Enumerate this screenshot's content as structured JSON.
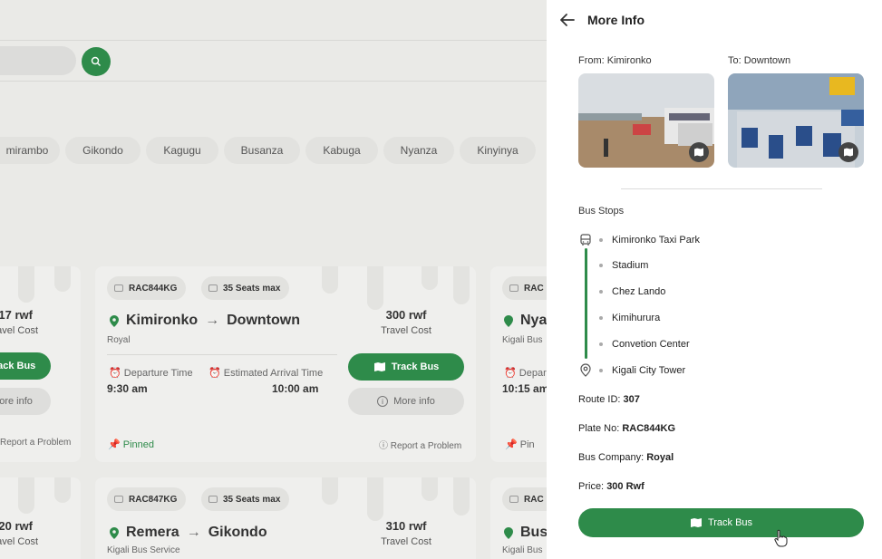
{
  "chips": [
    "mirambo",
    "Gikondo",
    "Kagugu",
    "Busanza",
    "Kabuga",
    "Nyanza",
    "Kinyinya"
  ],
  "cards": {
    "left_top": {
      "price": "17 rwf",
      "price_label": "avel Cost",
      "track": "Track Bus",
      "more": "More info",
      "report": "Report a Problem"
    },
    "main_top": {
      "plate": "RAC844KG",
      "seats": "35 Seats max",
      "from": "Kimironko",
      "to": "Downtown",
      "company": "Royal",
      "price": "300 rwf",
      "price_label": "Travel Cost",
      "dep_label": "Departure Time",
      "arr_label": "Estimated Arrival Time",
      "dep": "9:30 am",
      "arr": "10:00 am",
      "track": "Track Bus",
      "more": "More info",
      "pinned": "Pinned",
      "report": "Report a Problem"
    },
    "right_top": {
      "plate": "RAC",
      "from": "Nya",
      "company": "Kigali Bus",
      "dep_label": "Depar",
      "dep": "10:15 am",
      "pin": "Pin"
    },
    "left_bottom": {
      "price": "20 rwf",
      "price_label": "avel Cost"
    },
    "main_bottom": {
      "plate": "RAC847KG",
      "seats": "35 Seats max",
      "from": "Remera",
      "to": "Gikondo",
      "company": "Kigali Bus Service",
      "price": "310 rwf",
      "price_label": "Travel Cost"
    },
    "right_bottom": {
      "plate": "RAC",
      "from": "Bus",
      "company": "Kigali Bus"
    }
  },
  "panel": {
    "title": "More Info",
    "from_label": "From: Kimironko",
    "to_label": "To: Downtown",
    "bus_stops_label": "Bus Stops",
    "stops": [
      "Kimironko Taxi Park",
      "Stadium",
      "Chez Lando",
      "Kimihurura",
      "Convetion Center",
      "Kigali City Tower"
    ],
    "route_id_label": "Route ID:",
    "route_id": "307",
    "plate_label": "Plate No:",
    "plate": "RAC844KG",
    "company_label": "Bus Company:",
    "company": "Royal",
    "price_label": "Price:",
    "price": "300 Rwf",
    "track_button": "Track Bus"
  },
  "colors": {
    "accent": "#2e8b4a",
    "panel_bg": "#ffffff",
    "page_bg": "#eaeae7"
  }
}
